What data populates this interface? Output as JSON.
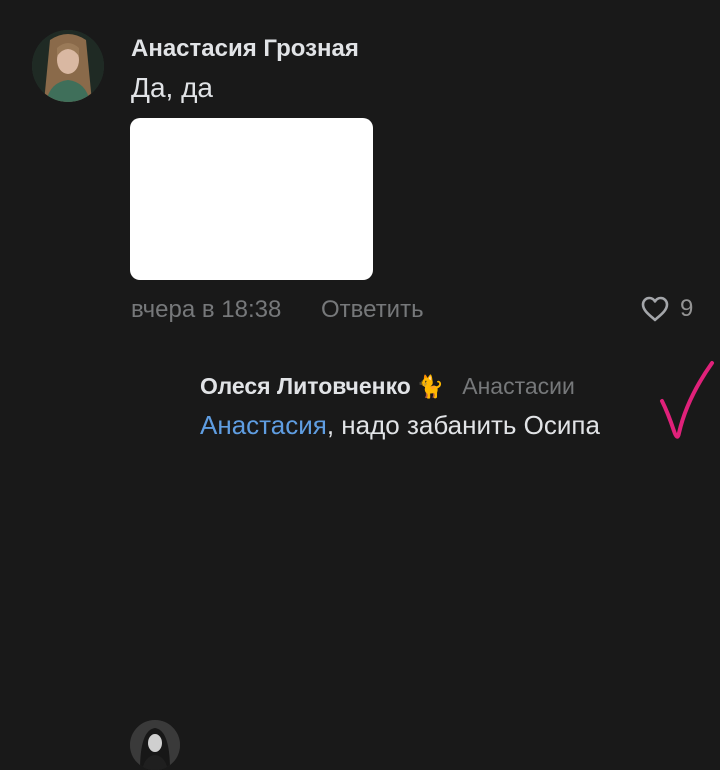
{
  "comment": {
    "author": "Анастасия Грозная",
    "text": "Да, да",
    "date": "вчера в 18:38",
    "reply_label": "Ответить",
    "likes": "9"
  },
  "reply": {
    "author": "Олеся Литовченко",
    "author_emoji": "🐈",
    "reply_to": "Анастасии",
    "mention": "Анастасия",
    "text_rest": ", надо забанить Осипа"
  },
  "icons": {
    "like": "heart-outline-icon",
    "author_emoji": "cat-icon",
    "annotation": "handwritten-checkmark"
  },
  "colors": {
    "background": "#191919",
    "primary_text": "#e1e3e6",
    "secondary_text": "#76787a",
    "mention": "#5f9de1",
    "annotation": "#e0217a"
  }
}
